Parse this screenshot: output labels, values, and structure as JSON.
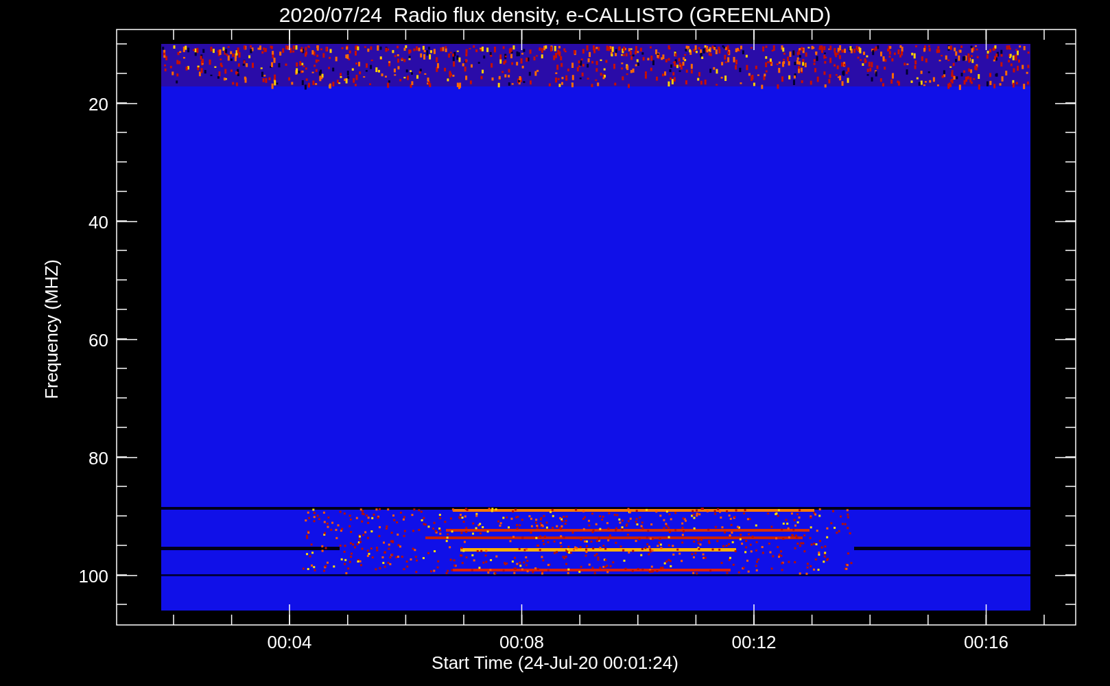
{
  "title": "2020/07/24  Radio flux density, e-CALLISTO (GREENLAND)",
  "ylabel": "Frequency (MHZ)",
  "xlabel": "Start Time (24-Jul-20 00:01:24)",
  "yticks": [
    "20",
    "40",
    "60",
    "80",
    "100"
  ],
  "xticks": [
    "00:04",
    "00:08",
    "00:12",
    "00:16"
  ]
}
